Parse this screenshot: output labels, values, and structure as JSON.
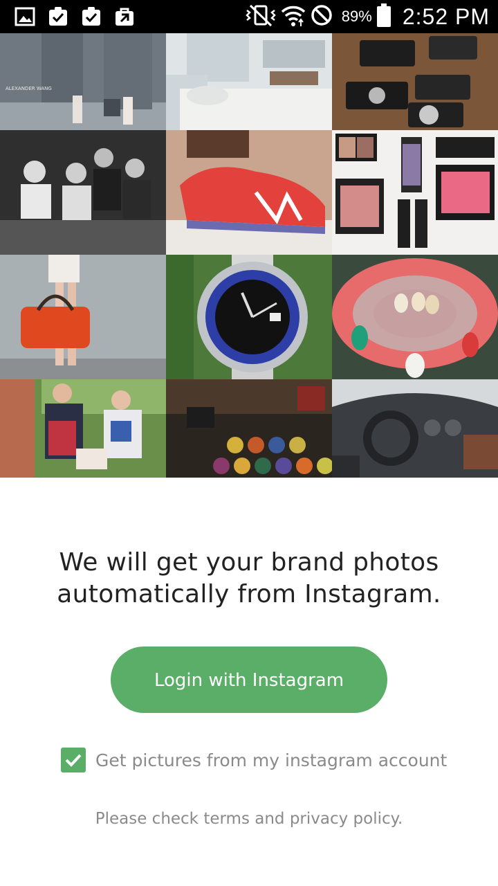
{
  "status_bar": {
    "battery_percent": "89%",
    "time": "2:52 PM",
    "left_icons": [
      "gallery-icon",
      "clipboard-check-icon",
      "clipboard-check-icon",
      "shopping-bag-icon"
    ],
    "right_icons": [
      "vibrate-mute-icon",
      "wifi-icon",
      "no-sim-icon",
      "battery-icon"
    ]
  },
  "photo_grid": {
    "tiles": [
      {
        "name": "fashion-show-photo",
        "caption": "ALEXANDER WANG"
      },
      {
        "name": "bedroom-photo"
      },
      {
        "name": "cameras-photo"
      },
      {
        "name": "audience-photo"
      },
      {
        "name": "sneaker-photo"
      },
      {
        "name": "makeup-photo"
      },
      {
        "name": "bag-photo"
      },
      {
        "name": "watch-photo"
      },
      {
        "name": "shoes-photo"
      },
      {
        "name": "street-style-photo"
      },
      {
        "name": "coffee-capsules-photo"
      },
      {
        "name": "car-interior-photo"
      }
    ]
  },
  "content": {
    "headline_line1": "We will get your brand photos",
    "headline_line2": "automatically from Instagram.",
    "login_button_label": "Login with Instagram",
    "checkbox_label": "Get pictures from my instagram account",
    "checkbox_checked": true,
    "policy_text": "Please check terms and privacy policy."
  },
  "colors": {
    "accent": "#5aae67",
    "status_bar_bg": "#000000",
    "headline": "#222222",
    "muted_text": "#8a8a8a"
  }
}
